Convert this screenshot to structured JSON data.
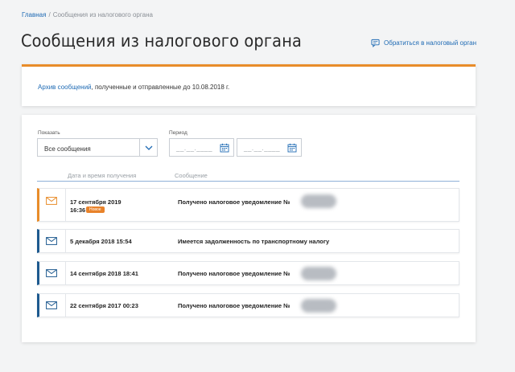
{
  "breadcrumb": {
    "home": "Главная",
    "separator": "/",
    "current": "Сообщения из налогового органа"
  },
  "page_title": "Сообщения из налогового органа",
  "contact_link": {
    "label": "Обратиться в налоговый орган",
    "icon": "chat-icon"
  },
  "archive": {
    "link": "Архив сообщений",
    "text": ", полученные и отправленные до 10.08.2018 г."
  },
  "filters": {
    "show_label": "Показать",
    "show_value": "Все сообщения",
    "period_label": "Период",
    "date_from_mask": "__.__.____",
    "date_to_mask": "__.__.____"
  },
  "columns": {
    "date": "Дата и время получения",
    "message": "Сообщение"
  },
  "messages": [
    {
      "date": "17 сентября 2019",
      "time": "16:36",
      "badge": "Новое",
      "text": "Получено налоговое уведомление №"
    },
    {
      "date": "5 декабря 2018 15:54",
      "text": "Имеется задолженность по транспортному налогу"
    },
    {
      "date": "14 сентября 2018 18:41",
      "text": "Получено налоговое уведомление №"
    },
    {
      "date": "22 сентября 2017 00:23",
      "text": "Получено налоговое уведомление №"
    }
  ],
  "colors": {
    "accent": "#e88c2a",
    "link": "#1e6ab4",
    "row_border": "#1e5a8f",
    "badge": "#e8822a"
  }
}
